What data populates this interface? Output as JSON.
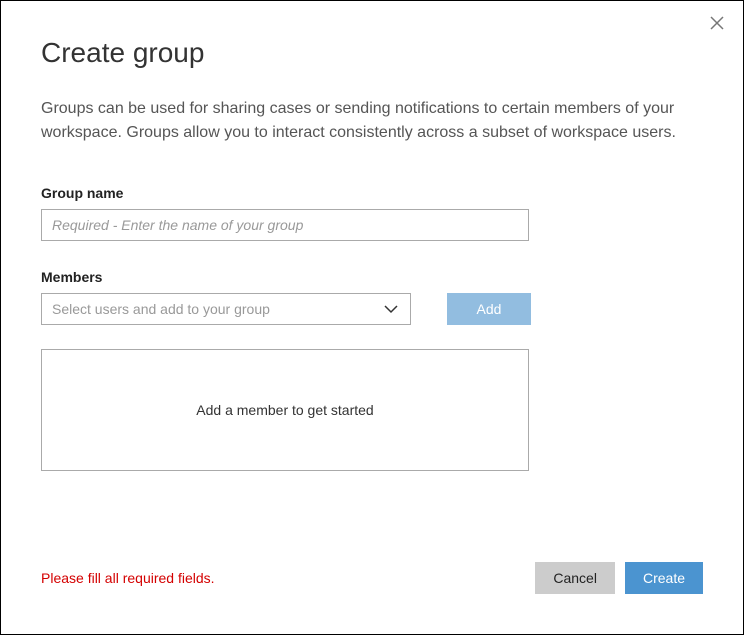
{
  "title": "Create group",
  "description": "Groups can be used for sharing cases or sending notifications to certain members of your workspace. Groups allow you to interact consistently across a subset of workspace users.",
  "groupName": {
    "label": "Group name",
    "placeholder": "Required - Enter the name of your group",
    "value": ""
  },
  "members": {
    "label": "Members",
    "selectPlaceholder": "Select users and add to your group",
    "addButton": "Add",
    "emptyMessage": "Add a member to get started"
  },
  "error": "Please fill all required fields.",
  "buttons": {
    "cancel": "Cancel",
    "create": "Create"
  }
}
